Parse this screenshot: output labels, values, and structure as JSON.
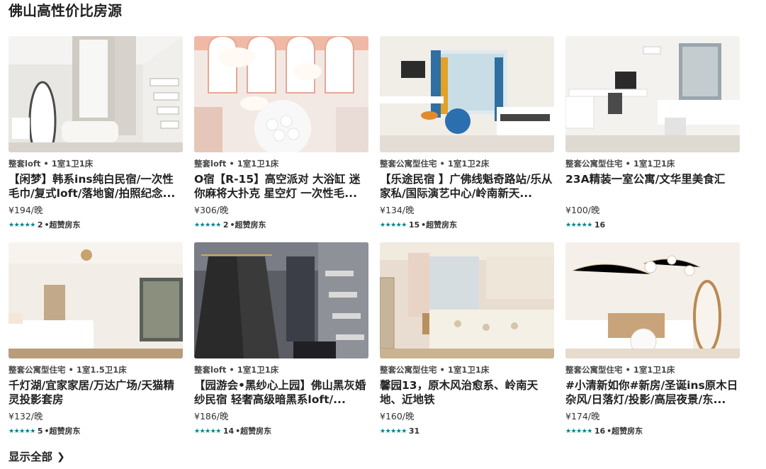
{
  "section": {
    "title": "佛山高性价比房源",
    "show_all_label": "显示全部",
    "star_glyphs": "★★★★★"
  },
  "listings": [
    {
      "meta": "整套loft • 1室1卫1床",
      "title": "【闲梦】韩系ins纯白民宿/一次性毛巾/复式loft/落地窗/拍照纪念...",
      "price": "¥194/晚",
      "reviews": "2",
      "badge": "•超赞房东",
      "stars": 5
    },
    {
      "meta": "整套loft • 1室1卫1床",
      "title": "O宿【R-15】高空派对 大浴缸 迷你麻将大扑克 星空灯 一次性毛...",
      "price": "¥306/晚",
      "reviews": "2",
      "badge": "•超赞房东",
      "stars": 5
    },
    {
      "meta": "整套公寓型住宅 • 1室1卫2床",
      "title": "【乐途民宿 】广佛线魁奇路站/乐从家私/国际演艺中心/岭南新天...",
      "price": "¥134/晚",
      "reviews": "15",
      "badge": "•超赞房东",
      "stars": 5
    },
    {
      "meta": "整套公寓型住宅 • 1室1卫1床",
      "title": "23A精装一室公寓/文华里美食汇",
      "price": "¥100/晚",
      "reviews": "16",
      "badge": "",
      "stars": 5
    },
    {
      "meta": "整套公寓型住宅 • 1室1.5卫1床",
      "title": "千灯湖/宜家家居/万达广场/天猫精灵投影套房",
      "price": "¥132/晚",
      "reviews": "5",
      "badge": "•超赞房东",
      "stars": 4.5
    },
    {
      "meta": "整套loft • 1室1卫1床",
      "title": "【园游会•黑纱心上园】佛山黑灰婚纱民宿 轻奢高级暗黑系loft/...",
      "price": "¥186/晚",
      "reviews": "14",
      "badge": "•超赞房东",
      "stars": 5
    },
    {
      "meta": "整套公寓型住宅 • 1室1卫1床",
      "title": "馨园13，原木风治愈系、岭南天地、近地铁",
      "price": "¥160/晚",
      "reviews": "31",
      "badge": "",
      "stars": 4.5
    },
    {
      "meta": "整套公寓型住宅 • 1室1卫1床",
      "title": "#小清新如你#新房/圣诞ins原木日杂风/日落灯/投影/高层夜景/东...",
      "price": "¥174/晚",
      "reviews": "16",
      "badge": "•超赞房东",
      "stars": 5
    }
  ],
  "colors": {
    "star": "#008489",
    "text": "#222222"
  }
}
